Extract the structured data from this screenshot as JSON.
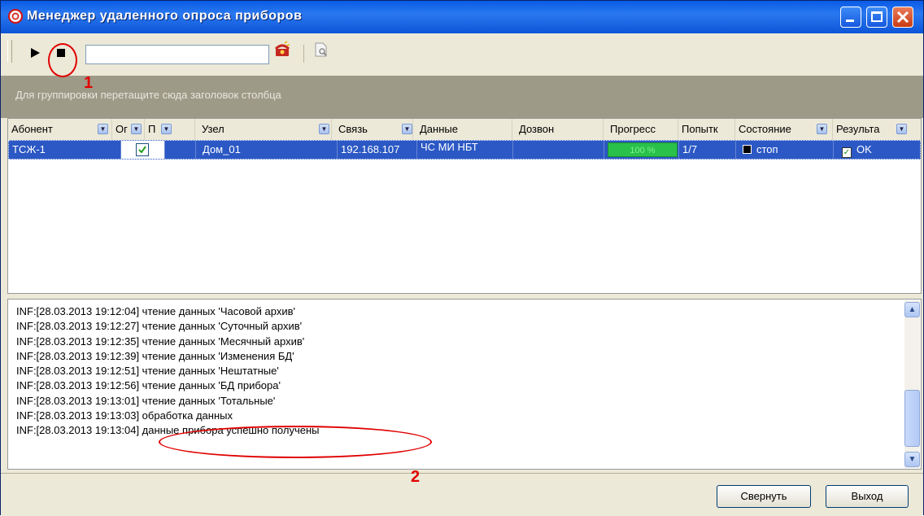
{
  "window": {
    "title": "Менеджер удаленного опроса приборов"
  },
  "toolbar": {
    "search_value": ""
  },
  "group_hint": "Для группировки перетащите сюда заголовок столбца",
  "columns": [
    "Абонент",
    "Ог",
    "П",
    "Узел",
    "Связь",
    "Данные",
    "Дозвон",
    "Прогресс",
    "Попытк",
    "Состояние",
    "Результа"
  ],
  "row": {
    "abonent": "ТСЖ-1",
    "checked": true,
    "node": "Дом_01",
    "link": "192.168.107",
    "data": "ЧС МИ НБТ",
    "dial": "",
    "progress_text": "100 %",
    "progress_value": 100,
    "attempts": "1/7",
    "state": "стоп",
    "result": "OK"
  },
  "log": [
    "INF:[28.03.2013 19:12:04] чтение данных 'Часовой архив'",
    "INF:[28.03.2013 19:12:27] чтение данных 'Суточный архив'",
    "INF:[28.03.2013 19:12:35] чтение данных 'Месячный архив'",
    "INF:[28.03.2013 19:12:39] чтение данных 'Изменения БД'",
    "INF:[28.03.2013 19:12:51] чтение данных 'Нештатные'",
    "INF:[28.03.2013 19:12:56] чтение данных 'БД прибора'",
    "INF:[28.03.2013 19:13:01] чтение данных 'Тотальные'",
    "INF:[28.03.2013 19:13:03] обработка данных",
    "INF:[28.03.2013 19:13:04] данные прибора успешно получены"
  ],
  "buttons": {
    "collapse": "Свернуть",
    "exit": "Выход"
  },
  "annotations": {
    "one": "1",
    "two": "2"
  },
  "colors": {
    "selection": "#2b58c4",
    "progress": "#29c14a",
    "annotation": "#e00000"
  }
}
